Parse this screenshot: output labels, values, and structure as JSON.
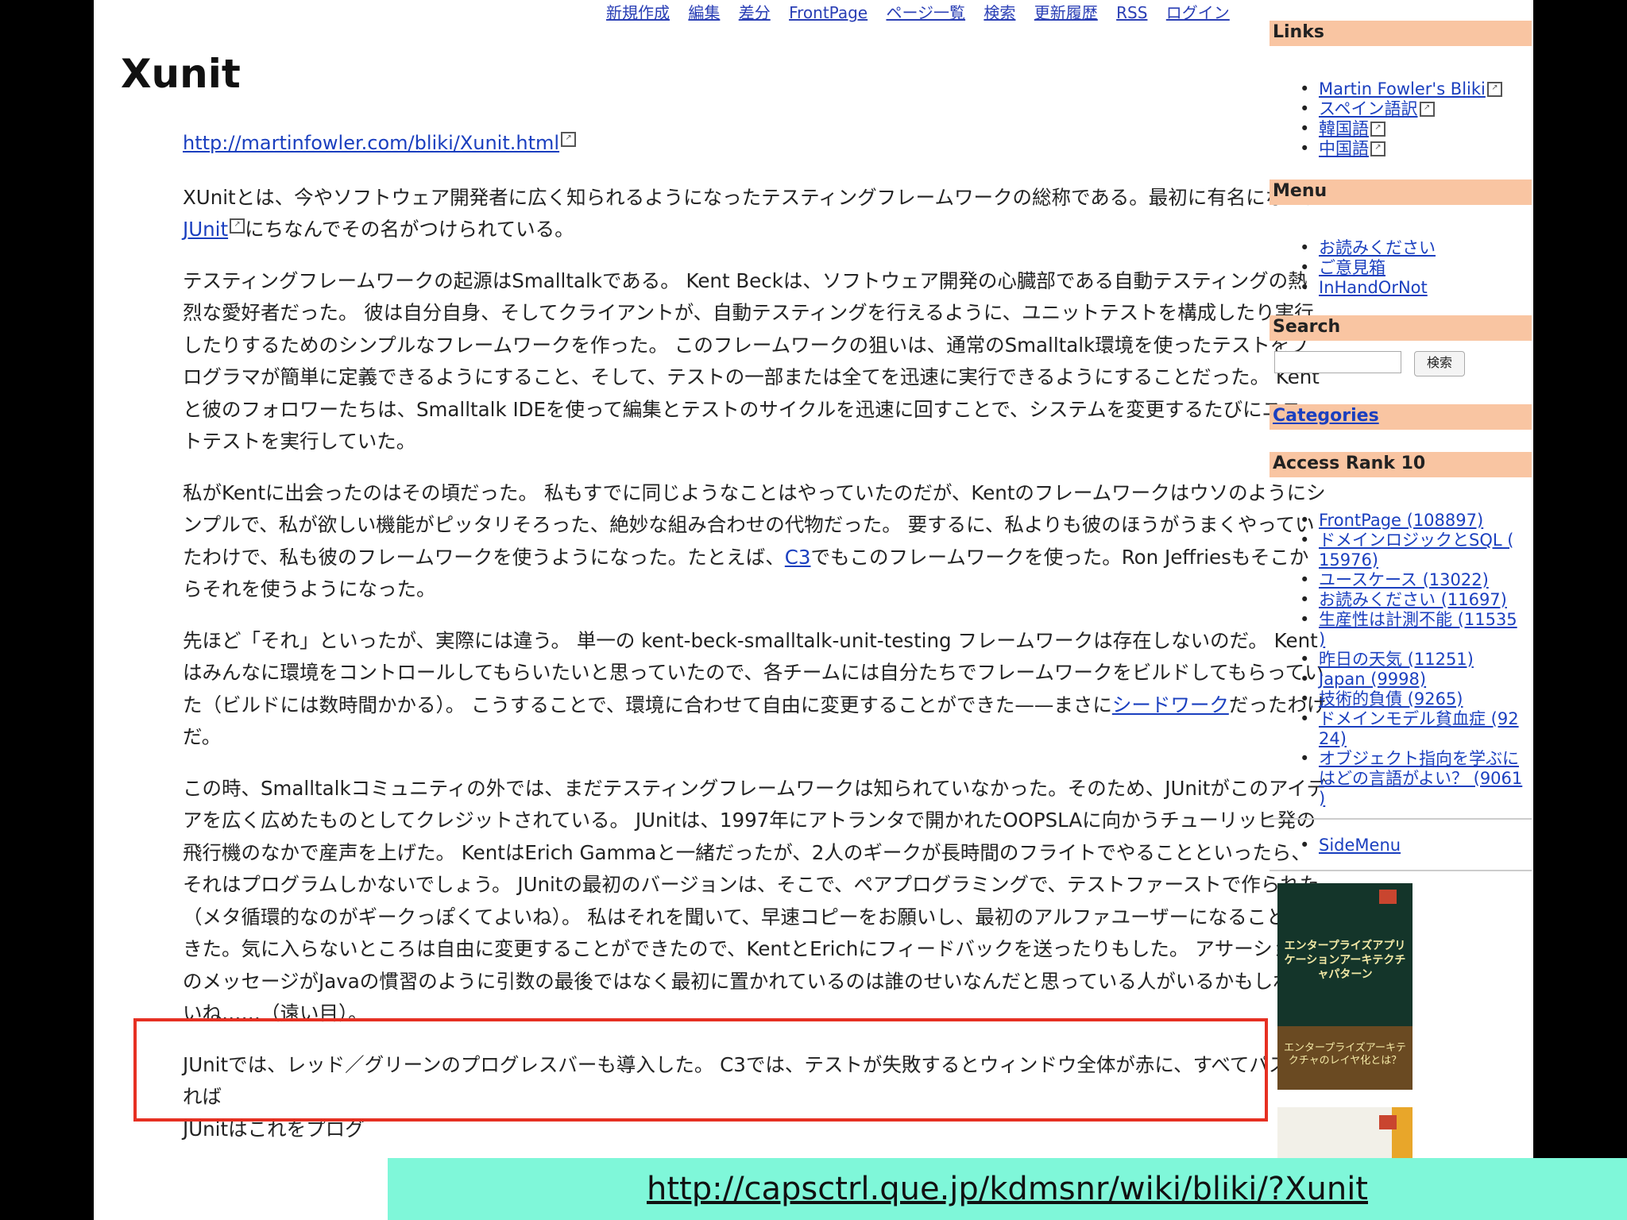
{
  "nav": {
    "items": [
      "新規作成",
      "編集",
      "差分",
      "FrontPage",
      "ページ一覧",
      "検索",
      "更新履歴",
      "RSS",
      "ログイン"
    ]
  },
  "title": "Xunit",
  "source_link": "http://martinfowler.com/bliki/Xunit.html",
  "ext_icon": "external-link-icon",
  "paragraphs": [
    [
      "XUnitとは、今やソフトウェア開発者に広く知られるようになったテスティングフレームワークの総称である。最初に有名になった",
      {
        "link": "JUnit",
        "ext": true
      },
      "にちなんでその名がつけられている。"
    ],
    [
      "テスティングフレームワークの起源はSmalltalkである。 Kent Beckは、ソフトウェア開発の心臓部である自動テスティングの熱烈な愛好者だった。 彼は自分自身、そしてクライアントが、自動テスティングを行えるように、ユニットテストを構成したり実行したりするためのシンプルなフレームワークを作った。 このフレームワークの狙いは、通常のSmalltalk環境を使ったテストをプログラマが簡単に定義できるようにすること、そして、テストの一部または全てを迅速に実行できるようにすることだった。 Kentと彼のフォロワーたちは、Smalltalk IDEを使って編集とテストのサイクルを迅速に回すことで、システムを変更するたびにユニットテストを実行していた。"
    ],
    [
      "私がKentに出会ったのはその頃だった。 私もすでに同じようなことはやっていたのだが、Kentのフレームワークはウソのようにシンプルで、私が欲しい機能がピッタリそろった、絶妙な組み合わせの代物だった。 要するに、私よりも彼のほうがうまくやっていたわけで、私も彼のフレームワークを使うようになった。たとえば、",
      {
        "link": "C3"
      },
      "でもこのフレームワークを使った。Ron Jeffriesもそこからそれを使うようになった。"
    ],
    [
      "先ほど「それ」といったが、実際には違う。 単一の kent-beck-smalltalk-unit-testing フレームワークは存在しないのだ。 Kentはみんなに環境をコントロールしてもらいたいと思っていたので、各チームには自分たちでフレームワークをビルドしてもらっていた（ビルドには数時間かかる）。 こうすることで、環境に合わせて自由に変更することができた——まさに",
      {
        "link": "シードワーク"
      },
      "だったわけだ。"
    ],
    [
      "この時、Smalltalkコミュニティの外では、まだテスティングフレームワークは知られていなかった。そのため、JUnitがこのアイデアを広く広めたものとしてクレジットされている。 JUnitは、1997年にアトランタで開かれたOOPSLAに向かうチューリッヒ発の飛行機のなかで産声を上げた。 KentはErich Gammaと一緒だったが、2人のギークが長時間のフライトでやることといったら、それはプログラムしかないでしょう。 JUnitの最初のバージョンは、そこで、ペアプログラミングで、テストファーストで作られた（メタ循環的なのがギークっぽくてよいね）。 私はそれを聞いて、早速コピーをお願いし、最初のアルファユーザーになることができた。気に入らないところは自由に変更することができたので、KentとErichにフィードバックを送ったりもした。 アサーションのメッセージがJavaの慣習のように引数の最後ではなく最初に置かれているのは誰のせいなんだと思っている人がいるかもしれないね……（遠い目）。"
    ],
    [
      "JUnitでは、レッド／グリーンのプログレスバーも導入した。 C3では、テストが失敗するとウィンドウ全体が赤に、すべてパスすれば",
      "",
      ""
    ],
    [
      "JUnitはこれをプログ"
    ]
  ],
  "sidebar": {
    "links": {
      "heading": "Links",
      "items": [
        {
          "label": "Martin Fowler's Bliki",
          "ext": true
        },
        {
          "label": "スペイン語訳",
          "ext": true
        },
        {
          "label": "韓国語",
          "ext": true
        },
        {
          "label": "中国語",
          "ext": true
        }
      ]
    },
    "menu": {
      "heading": "Menu",
      "items": [
        "お読みください",
        "ご意見箱",
        "InHandOrNot"
      ]
    },
    "search": {
      "heading": "Search",
      "input_value": "",
      "button_label": "検索"
    },
    "categories": {
      "heading": "Categories"
    },
    "access_rank": {
      "heading": "Access Rank 10",
      "items": [
        [
          "FrontPage (108897)"
        ],
        [
          "ドメインロジックとSQL (",
          "15976)"
        ],
        [
          "ユースケース (13022)"
        ],
        [
          "お読みください (11697)"
        ],
        [
          "生産性は計測不能 (11535",
          ")"
        ],
        [
          "昨日の天気 (11251)"
        ],
        [
          "Japan (9998)"
        ],
        [
          "技術的負債 (9265)"
        ],
        [
          "ドメインモデル貧血症 (92",
          "24)"
        ],
        [
          "オブジェクト指向を学ぶに",
          "はどの言語がよい？ (9061",
          ")"
        ]
      ]
    },
    "sidemenu": {
      "items": [
        "SideMenu"
      ]
    },
    "book1": {
      "title": "エンタープライズアプリケーションアーキテクチャパターン",
      "subtitle": "エンタープライズアーキテクチャのレイヤ化とは？"
    }
  },
  "banner_url": "http://capsctrl.que.jp/kdmsnr/wiki/bliki/?Xunit"
}
